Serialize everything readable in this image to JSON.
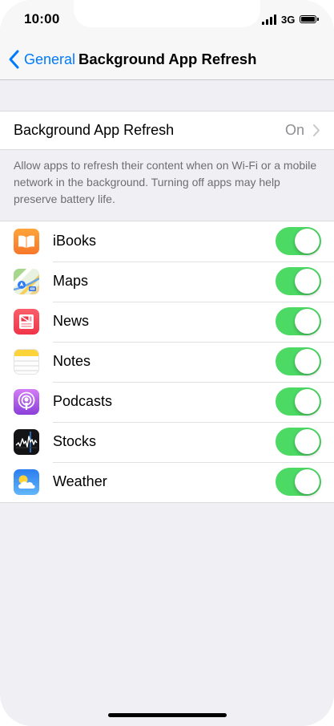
{
  "status_bar": {
    "time": "10:00",
    "network": "3G",
    "icons": [
      "signal-icon",
      "battery-icon"
    ]
  },
  "nav": {
    "back_label": "General",
    "title": "Background App Refresh"
  },
  "refresh_setting": {
    "label": "Background App Refresh",
    "value": "On"
  },
  "footer": "Allow apps to refresh their content when on Wi-Fi or a mobile network in the background. Turning off apps may help preserve battery life.",
  "apps": [
    {
      "name": "iBooks",
      "icon": "ibooks-icon",
      "enabled": true
    },
    {
      "name": "Maps",
      "icon": "maps-icon",
      "enabled": true
    },
    {
      "name": "News",
      "icon": "news-icon",
      "enabled": true
    },
    {
      "name": "Notes",
      "icon": "notes-icon",
      "enabled": true
    },
    {
      "name": "Podcasts",
      "icon": "podcasts-icon",
      "enabled": true
    },
    {
      "name": "Stocks",
      "icon": "stocks-icon",
      "enabled": true
    },
    {
      "name": "Weather",
      "icon": "weather-icon",
      "enabled": true
    }
  ],
  "colors": {
    "accent": "#007aff",
    "toggle_on": "#4cd964",
    "background": "#efeff4"
  }
}
